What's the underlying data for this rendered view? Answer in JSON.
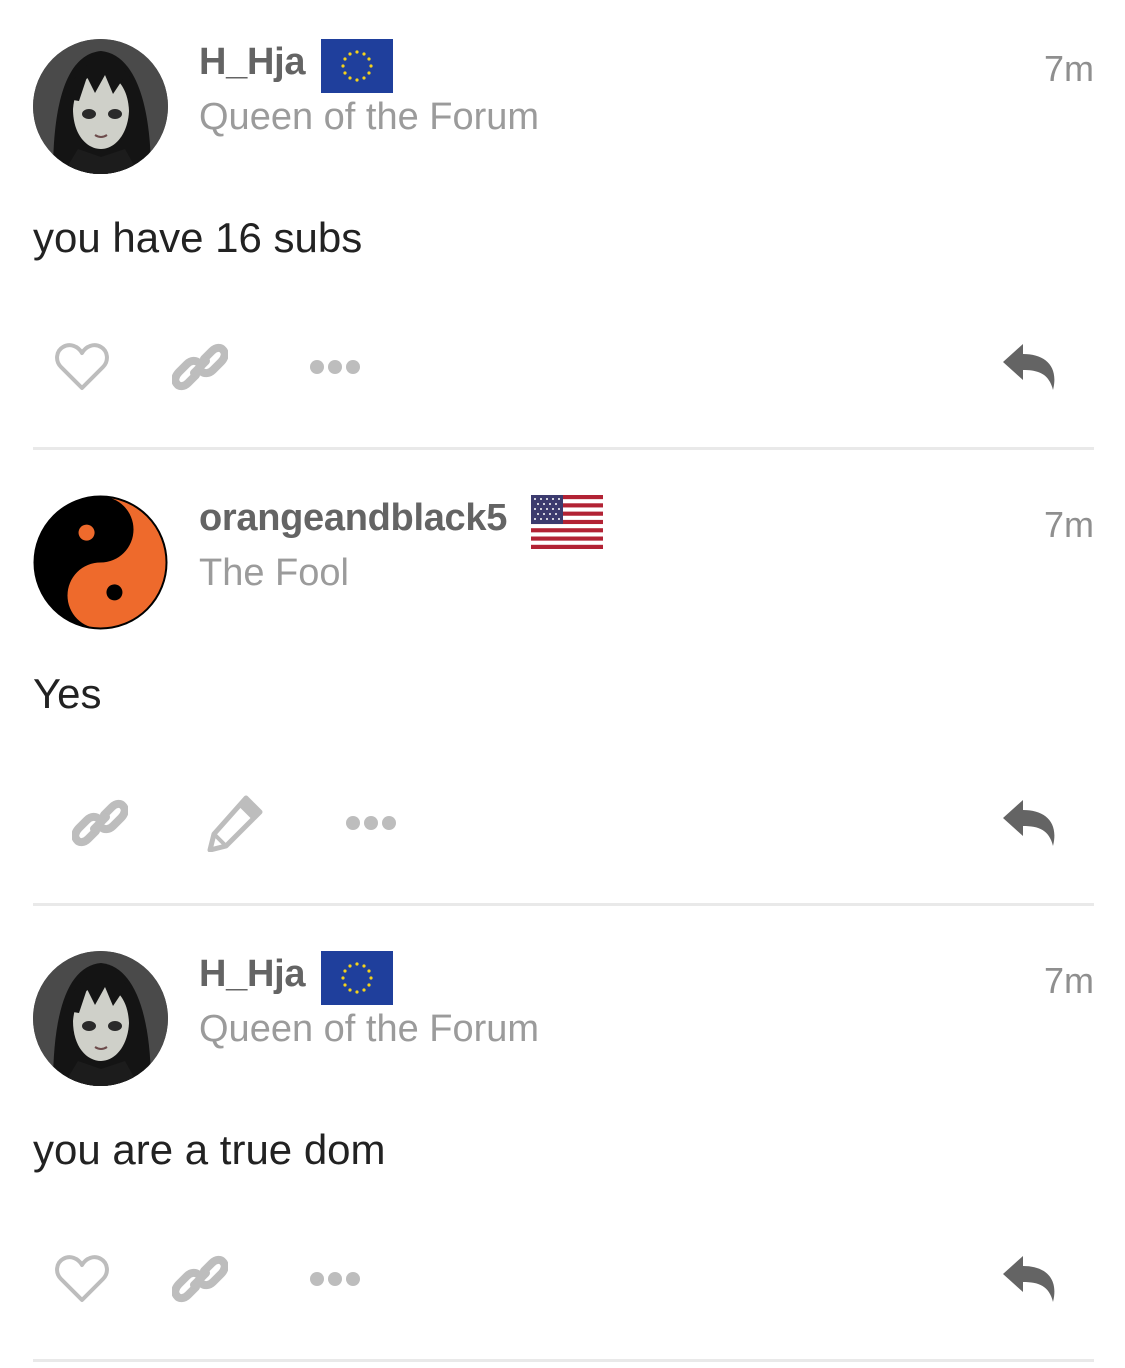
{
  "posts": [
    {
      "username": "H_Hja",
      "flag": "eu-flag",
      "user_title": "Queen of the Forum",
      "time": "7m",
      "text": "you have 16 subs",
      "avatar": "anime-girl-avatar",
      "actions": [
        "like",
        "link",
        "more",
        "reply"
      ]
    },
    {
      "username": "orangeandblack5",
      "flag": "us-flag",
      "user_title": "The Fool",
      "time": "7m",
      "text": "Yes",
      "avatar": "yin-yang-avatar",
      "actions": [
        "link",
        "edit",
        "more",
        "reply"
      ]
    },
    {
      "username": "H_Hja",
      "flag": "eu-flag",
      "user_title": "Queen of the Forum",
      "time": "7m",
      "text": "you are a true dom",
      "avatar": "anime-girl-avatar",
      "actions": [
        "like",
        "link",
        "more",
        "reply"
      ]
    }
  ],
  "colors": {
    "username": "#646464",
    "user_title": "#9b9b9b",
    "icon_light": "#bdbdbd",
    "icon_dark": "#646464",
    "divider": "#e9e9e9",
    "yin_yang_orange": "#ee6a2c",
    "eu_blue": "#1f3f9c",
    "eu_star": "#f5d21a"
  }
}
